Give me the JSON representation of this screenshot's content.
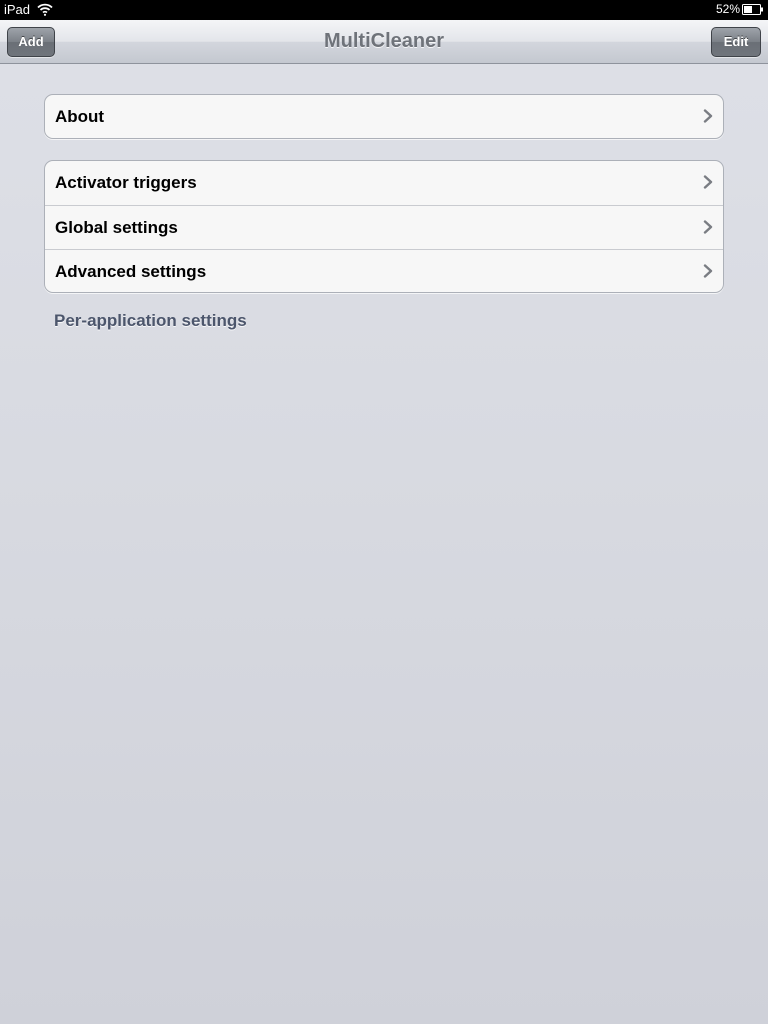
{
  "status_bar": {
    "carrier": "iPad",
    "battery": "52%"
  },
  "nav_bar": {
    "title": "MultiCleaner",
    "left_button": "Add",
    "right_button": "Edit"
  },
  "groups": [
    {
      "items": [
        {
          "label": "About"
        }
      ]
    },
    {
      "items": [
        {
          "label": "Activator triggers"
        },
        {
          "label": "Global settings"
        },
        {
          "label": "Advanced settings"
        }
      ]
    }
  ],
  "section_footer": "Per-application settings",
  "icons": {
    "wifi": "wifi-icon",
    "battery": "battery-icon",
    "disclosure": "chevron-right-icon"
  },
  "colors": {
    "nav_title": "#6f737a",
    "section_footer": "#4c566c",
    "cell_bg": "#f7f7f7",
    "background": "#dee0e7"
  }
}
